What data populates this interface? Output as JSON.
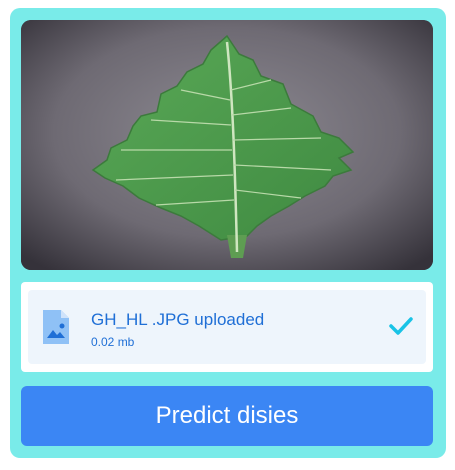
{
  "upload_card": {
    "preview_image": {
      "icon": "leaf-photo",
      "colors": {
        "background": "#6f6b74",
        "leaf": "#4c9a4a",
        "vein": "#cfe6c0"
      }
    },
    "file": {
      "icon": "image-file-icon",
      "name_text": "GH_HL .JPG uploaded",
      "size_text": "0.02 mb",
      "status_icon": "check-icon"
    },
    "predict_button_label": "Predict disies"
  },
  "colors": {
    "card_background": "#79ebe9",
    "button": "#3b86f4",
    "file_text": "#1f6fd6",
    "check": "#19c3e6"
  }
}
